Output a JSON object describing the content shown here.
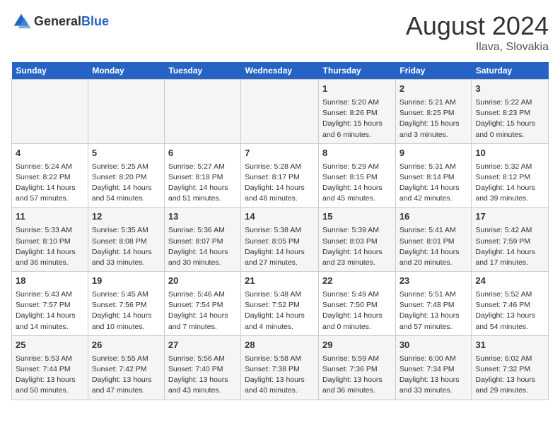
{
  "header": {
    "logo_general": "General",
    "logo_blue": "Blue",
    "month": "August 2024",
    "location": "Ilava, Slovakia"
  },
  "weekdays": [
    "Sunday",
    "Monday",
    "Tuesday",
    "Wednesday",
    "Thursday",
    "Friday",
    "Saturday"
  ],
  "weeks": [
    [
      {
        "day": "",
        "content": ""
      },
      {
        "day": "",
        "content": ""
      },
      {
        "day": "",
        "content": ""
      },
      {
        "day": "",
        "content": ""
      },
      {
        "day": "1",
        "content": "Sunrise: 5:20 AM\nSunset: 8:26 PM\nDaylight: 15 hours\nand 6 minutes."
      },
      {
        "day": "2",
        "content": "Sunrise: 5:21 AM\nSunset: 8:25 PM\nDaylight: 15 hours\nand 3 minutes."
      },
      {
        "day": "3",
        "content": "Sunrise: 5:22 AM\nSunset: 8:23 PM\nDaylight: 15 hours\nand 0 minutes."
      }
    ],
    [
      {
        "day": "4",
        "content": "Sunrise: 5:24 AM\nSunset: 8:22 PM\nDaylight: 14 hours\nand 57 minutes."
      },
      {
        "day": "5",
        "content": "Sunrise: 5:25 AM\nSunset: 8:20 PM\nDaylight: 14 hours\nand 54 minutes."
      },
      {
        "day": "6",
        "content": "Sunrise: 5:27 AM\nSunset: 8:18 PM\nDaylight: 14 hours\nand 51 minutes."
      },
      {
        "day": "7",
        "content": "Sunrise: 5:28 AM\nSunset: 8:17 PM\nDaylight: 14 hours\nand 48 minutes."
      },
      {
        "day": "8",
        "content": "Sunrise: 5:29 AM\nSunset: 8:15 PM\nDaylight: 14 hours\nand 45 minutes."
      },
      {
        "day": "9",
        "content": "Sunrise: 5:31 AM\nSunset: 8:14 PM\nDaylight: 14 hours\nand 42 minutes."
      },
      {
        "day": "10",
        "content": "Sunrise: 5:32 AM\nSunset: 8:12 PM\nDaylight: 14 hours\nand 39 minutes."
      }
    ],
    [
      {
        "day": "11",
        "content": "Sunrise: 5:33 AM\nSunset: 8:10 PM\nDaylight: 14 hours\nand 36 minutes."
      },
      {
        "day": "12",
        "content": "Sunrise: 5:35 AM\nSunset: 8:08 PM\nDaylight: 14 hours\nand 33 minutes."
      },
      {
        "day": "13",
        "content": "Sunrise: 5:36 AM\nSunset: 8:07 PM\nDaylight: 14 hours\nand 30 minutes."
      },
      {
        "day": "14",
        "content": "Sunrise: 5:38 AM\nSunset: 8:05 PM\nDaylight: 14 hours\nand 27 minutes."
      },
      {
        "day": "15",
        "content": "Sunrise: 5:39 AM\nSunset: 8:03 PM\nDaylight: 14 hours\nand 23 minutes."
      },
      {
        "day": "16",
        "content": "Sunrise: 5:41 AM\nSunset: 8:01 PM\nDaylight: 14 hours\nand 20 minutes."
      },
      {
        "day": "17",
        "content": "Sunrise: 5:42 AM\nSunset: 7:59 PM\nDaylight: 14 hours\nand 17 minutes."
      }
    ],
    [
      {
        "day": "18",
        "content": "Sunrise: 5:43 AM\nSunset: 7:57 PM\nDaylight: 14 hours\nand 14 minutes."
      },
      {
        "day": "19",
        "content": "Sunrise: 5:45 AM\nSunset: 7:56 PM\nDaylight: 14 hours\nand 10 minutes."
      },
      {
        "day": "20",
        "content": "Sunrise: 5:46 AM\nSunset: 7:54 PM\nDaylight: 14 hours\nand 7 minutes."
      },
      {
        "day": "21",
        "content": "Sunrise: 5:48 AM\nSunset: 7:52 PM\nDaylight: 14 hours\nand 4 minutes."
      },
      {
        "day": "22",
        "content": "Sunrise: 5:49 AM\nSunset: 7:50 PM\nDaylight: 14 hours\nand 0 minutes."
      },
      {
        "day": "23",
        "content": "Sunrise: 5:51 AM\nSunset: 7:48 PM\nDaylight: 13 hours\nand 57 minutes."
      },
      {
        "day": "24",
        "content": "Sunrise: 5:52 AM\nSunset: 7:46 PM\nDaylight: 13 hours\nand 54 minutes."
      }
    ],
    [
      {
        "day": "25",
        "content": "Sunrise: 5:53 AM\nSunset: 7:44 PM\nDaylight: 13 hours\nand 50 minutes."
      },
      {
        "day": "26",
        "content": "Sunrise: 5:55 AM\nSunset: 7:42 PM\nDaylight: 13 hours\nand 47 minutes."
      },
      {
        "day": "27",
        "content": "Sunrise: 5:56 AM\nSunset: 7:40 PM\nDaylight: 13 hours\nand 43 minutes."
      },
      {
        "day": "28",
        "content": "Sunrise: 5:58 AM\nSunset: 7:38 PM\nDaylight: 13 hours\nand 40 minutes."
      },
      {
        "day": "29",
        "content": "Sunrise: 5:59 AM\nSunset: 7:36 PM\nDaylight: 13 hours\nand 36 minutes."
      },
      {
        "day": "30",
        "content": "Sunrise: 6:00 AM\nSunset: 7:34 PM\nDaylight: 13 hours\nand 33 minutes."
      },
      {
        "day": "31",
        "content": "Sunrise: 6:02 AM\nSunset: 7:32 PM\nDaylight: 13 hours\nand 29 minutes."
      }
    ]
  ]
}
